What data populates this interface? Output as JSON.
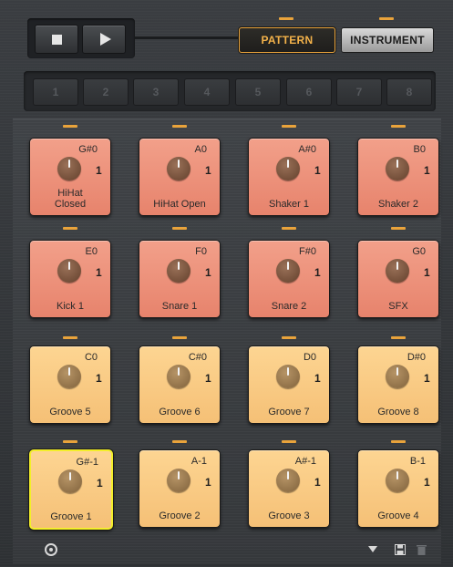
{
  "transport": {
    "stop_icon": "stop-icon",
    "play_icon": "play-icon"
  },
  "modes": {
    "pattern_label": "PATTERN",
    "instrument_label": "INSTRUMENT",
    "active": "PATTERN",
    "accent_color": "#e9a33b"
  },
  "slots": [
    "1",
    "2",
    "3",
    "4",
    "5",
    "6",
    "7",
    "8"
  ],
  "pads": [
    {
      "note": "G#0",
      "velocity": "1",
      "name": "HiHat\nClosed",
      "color": "red"
    },
    {
      "note": "A0",
      "velocity": "1",
      "name": "HiHat Open",
      "color": "red"
    },
    {
      "note": "A#0",
      "velocity": "1",
      "name": "Shaker 1",
      "color": "red"
    },
    {
      "note": "B0",
      "velocity": "1",
      "name": "Shaker 2",
      "color": "red"
    },
    {
      "note": "E0",
      "velocity": "1",
      "name": "Kick 1",
      "color": "red"
    },
    {
      "note": "F0",
      "velocity": "1",
      "name": "Snare 1",
      "color": "red"
    },
    {
      "note": "F#0",
      "velocity": "1",
      "name": "Snare 2",
      "color": "red"
    },
    {
      "note": "G0",
      "velocity": "1",
      "name": "SFX",
      "color": "red"
    },
    {
      "note": "C0",
      "velocity": "1",
      "name": "Groove 5",
      "color": "yellow"
    },
    {
      "note": "C#0",
      "velocity": "1",
      "name": "Groove 6",
      "color": "yellow"
    },
    {
      "note": "D0",
      "velocity": "1",
      "name": "Groove 7",
      "color": "yellow"
    },
    {
      "note": "D#0",
      "velocity": "1",
      "name": "Groove 8",
      "color": "yellow"
    },
    {
      "note": "G#-1",
      "velocity": "1",
      "name": "Groove 1",
      "color": "yellow",
      "selected": true
    },
    {
      "note": "A-1",
      "velocity": "1",
      "name": "Groove 2",
      "color": "yellow"
    },
    {
      "note": "A#-1",
      "velocity": "1",
      "name": "Groove 3",
      "color": "yellow"
    },
    {
      "note": "B-1",
      "velocity": "1",
      "name": "Groove 4",
      "color": "yellow"
    }
  ],
  "bottom": {
    "left_icon": "settings-gear-icon",
    "dropdown_icon": "chevron-down-icon",
    "save_icon": "save-icon",
    "trash_icon": "trash-icon"
  }
}
